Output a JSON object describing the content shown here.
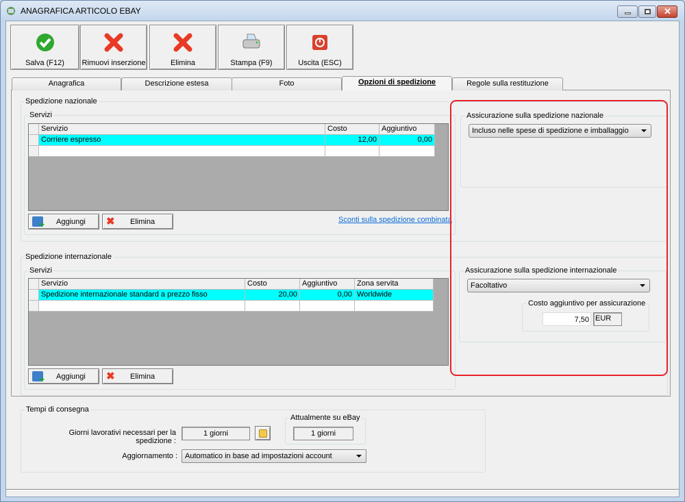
{
  "window": {
    "title": "ANAGRAFICA ARTICOLO EBAY"
  },
  "toolbar": [
    {
      "label": "Salva (F12)",
      "icon": "check-icon"
    },
    {
      "label": "Rimuovi inserzione",
      "icon": "red-x-icon"
    },
    {
      "label": "Elimina",
      "icon": "red-x-icon"
    },
    {
      "label": "Stampa (F9)",
      "icon": "printer-icon"
    },
    {
      "label": "Uscita (ESC)",
      "icon": "power-icon"
    }
  ],
  "tabs": [
    "Anagrafica",
    "Descrizione estesa",
    "Foto",
    "Opzioni di spedizione",
    "Regole sulla restituzione"
  ],
  "national": {
    "title": "Spedizione nazionale",
    "services_label": "Servizi",
    "columns": [
      "Servizio",
      "Costo",
      "Aggiuntivo"
    ],
    "rows": [
      [
        "Corriere espresso",
        "12,00",
        "0,00"
      ]
    ],
    "add_label": "Aggiungi",
    "delete_label": "Elimina",
    "link": "Sconti sulla spedizione combinata",
    "insurance_label": "Assicurazione sulla spedizione nazionale",
    "insurance_value": "Incluso nelle spese di spedizione e imballaggio"
  },
  "international": {
    "title": "Spedizione internazionale",
    "services_label": "Servizi",
    "columns": [
      "Servizio",
      "Costo",
      "Aggiuntivo",
      "Zona servita"
    ],
    "rows": [
      [
        "Spedizione internazionale standard a prezzo fisso",
        "20,00",
        "0,00",
        "Worldwide"
      ]
    ],
    "add_label": "Aggiungi",
    "delete_label": "Elimina",
    "insurance_label": "Assicurazione sulla spedizione internazionale",
    "insurance_value": "Facoltativo",
    "cost_label": "Costo aggiuntivo per assicurazione",
    "cost_value": "7,50",
    "currency": "EUR"
  },
  "delivery": {
    "title": "Tempi di consegna",
    "days_label": "Giorni lavorativi necessari per la spedizione :",
    "days_value": "1 giorni",
    "current_label": "Attualmente su eBay",
    "current_value": "1 giorni",
    "update_label": "Aggiornamento :",
    "update_value": "Automatico in base ad impostazioni account"
  },
  "colors": {
    "highlight": "#00ffff",
    "annotation": "#e8202a"
  }
}
